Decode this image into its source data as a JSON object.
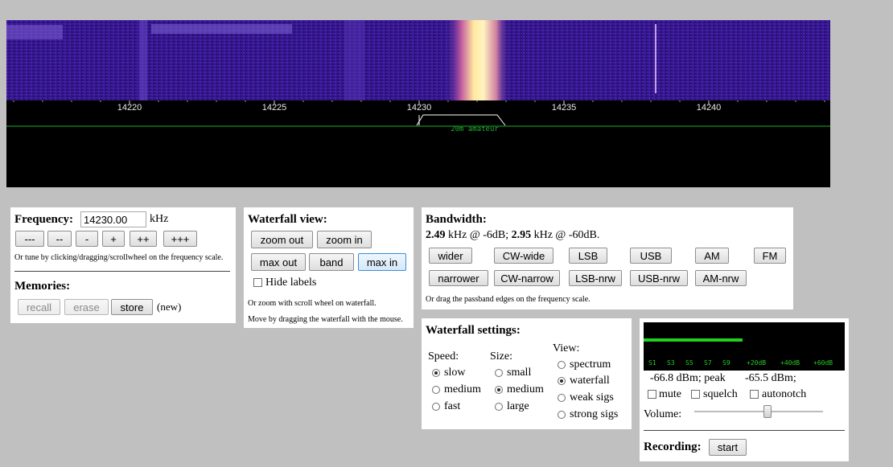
{
  "scale": {
    "ticks": [
      "14220",
      "14225",
      "14230",
      "14235",
      "14240"
    ],
    "band_label": "20m amateur"
  },
  "frequency": {
    "label": "Frequency:",
    "value": "14230.00",
    "unit": "kHz",
    "tune_buttons": [
      "---",
      "--",
      "-",
      "+",
      "++",
      "+++"
    ],
    "hint": "Or tune by clicking/dragging/scrollwheel on the frequency scale."
  },
  "memories": {
    "label": "Memories:",
    "recall": "recall",
    "erase": "erase",
    "store": "store",
    "status": "(new)"
  },
  "waterfall_view": {
    "title": "Waterfall view:",
    "zoom_out": "zoom out",
    "zoom_in": "zoom in",
    "max_out": "max out",
    "band": "band",
    "max_in": "max in",
    "hide_labels": "Hide labels",
    "hint1": "Or zoom with scroll wheel on waterfall.",
    "hint2": "Move by dragging the waterfall with the mouse."
  },
  "bandwidth": {
    "title": "Bandwidth:",
    "bw6": "2.49",
    "text6": " kHz @ -6dB; ",
    "bw60": "2.95",
    "text60": " kHz @ -60dB.",
    "row1": [
      "wider",
      "CW-wide",
      "LSB",
      "USB",
      "AM",
      "FM"
    ],
    "row2": [
      "narrower",
      "CW-narrow",
      "LSB-nrw",
      "USB-nrw",
      "AM-nrw"
    ],
    "hint": "Or drag the passband edges on the frequency scale."
  },
  "waterfall_settings": {
    "title": "Waterfall settings:",
    "speed_label": "Speed:",
    "speed": [
      "slow",
      "medium",
      "fast"
    ],
    "speed_selected": 0,
    "size_label": "Size:",
    "size": [
      "small",
      "medium",
      "large"
    ],
    "size_selected": 1,
    "view_label": "View:",
    "view": [
      "spectrum",
      "waterfall",
      "weak sigs",
      "strong sigs"
    ],
    "view_selected": 1
  },
  "smeter": {
    "labels": [
      "S1",
      "S3",
      "S5",
      "S7",
      "S9",
      "+20dB",
      "+40dB",
      "+60dB"
    ],
    "level_fraction": 0.49,
    "reading": "-66.8 dBm; peak",
    "peak": "-65.5 dBm;",
    "mute": "mute",
    "squelch": "squelch",
    "autonotch": "autonotch",
    "volume_label": "Volume:",
    "volume_fraction": 0.57,
    "recording_label": "Recording:",
    "start": "start"
  },
  "colors": {
    "meter_bar": "#22d022",
    "meter_text": "#22d022",
    "band_line": "#1fae2f"
  }
}
